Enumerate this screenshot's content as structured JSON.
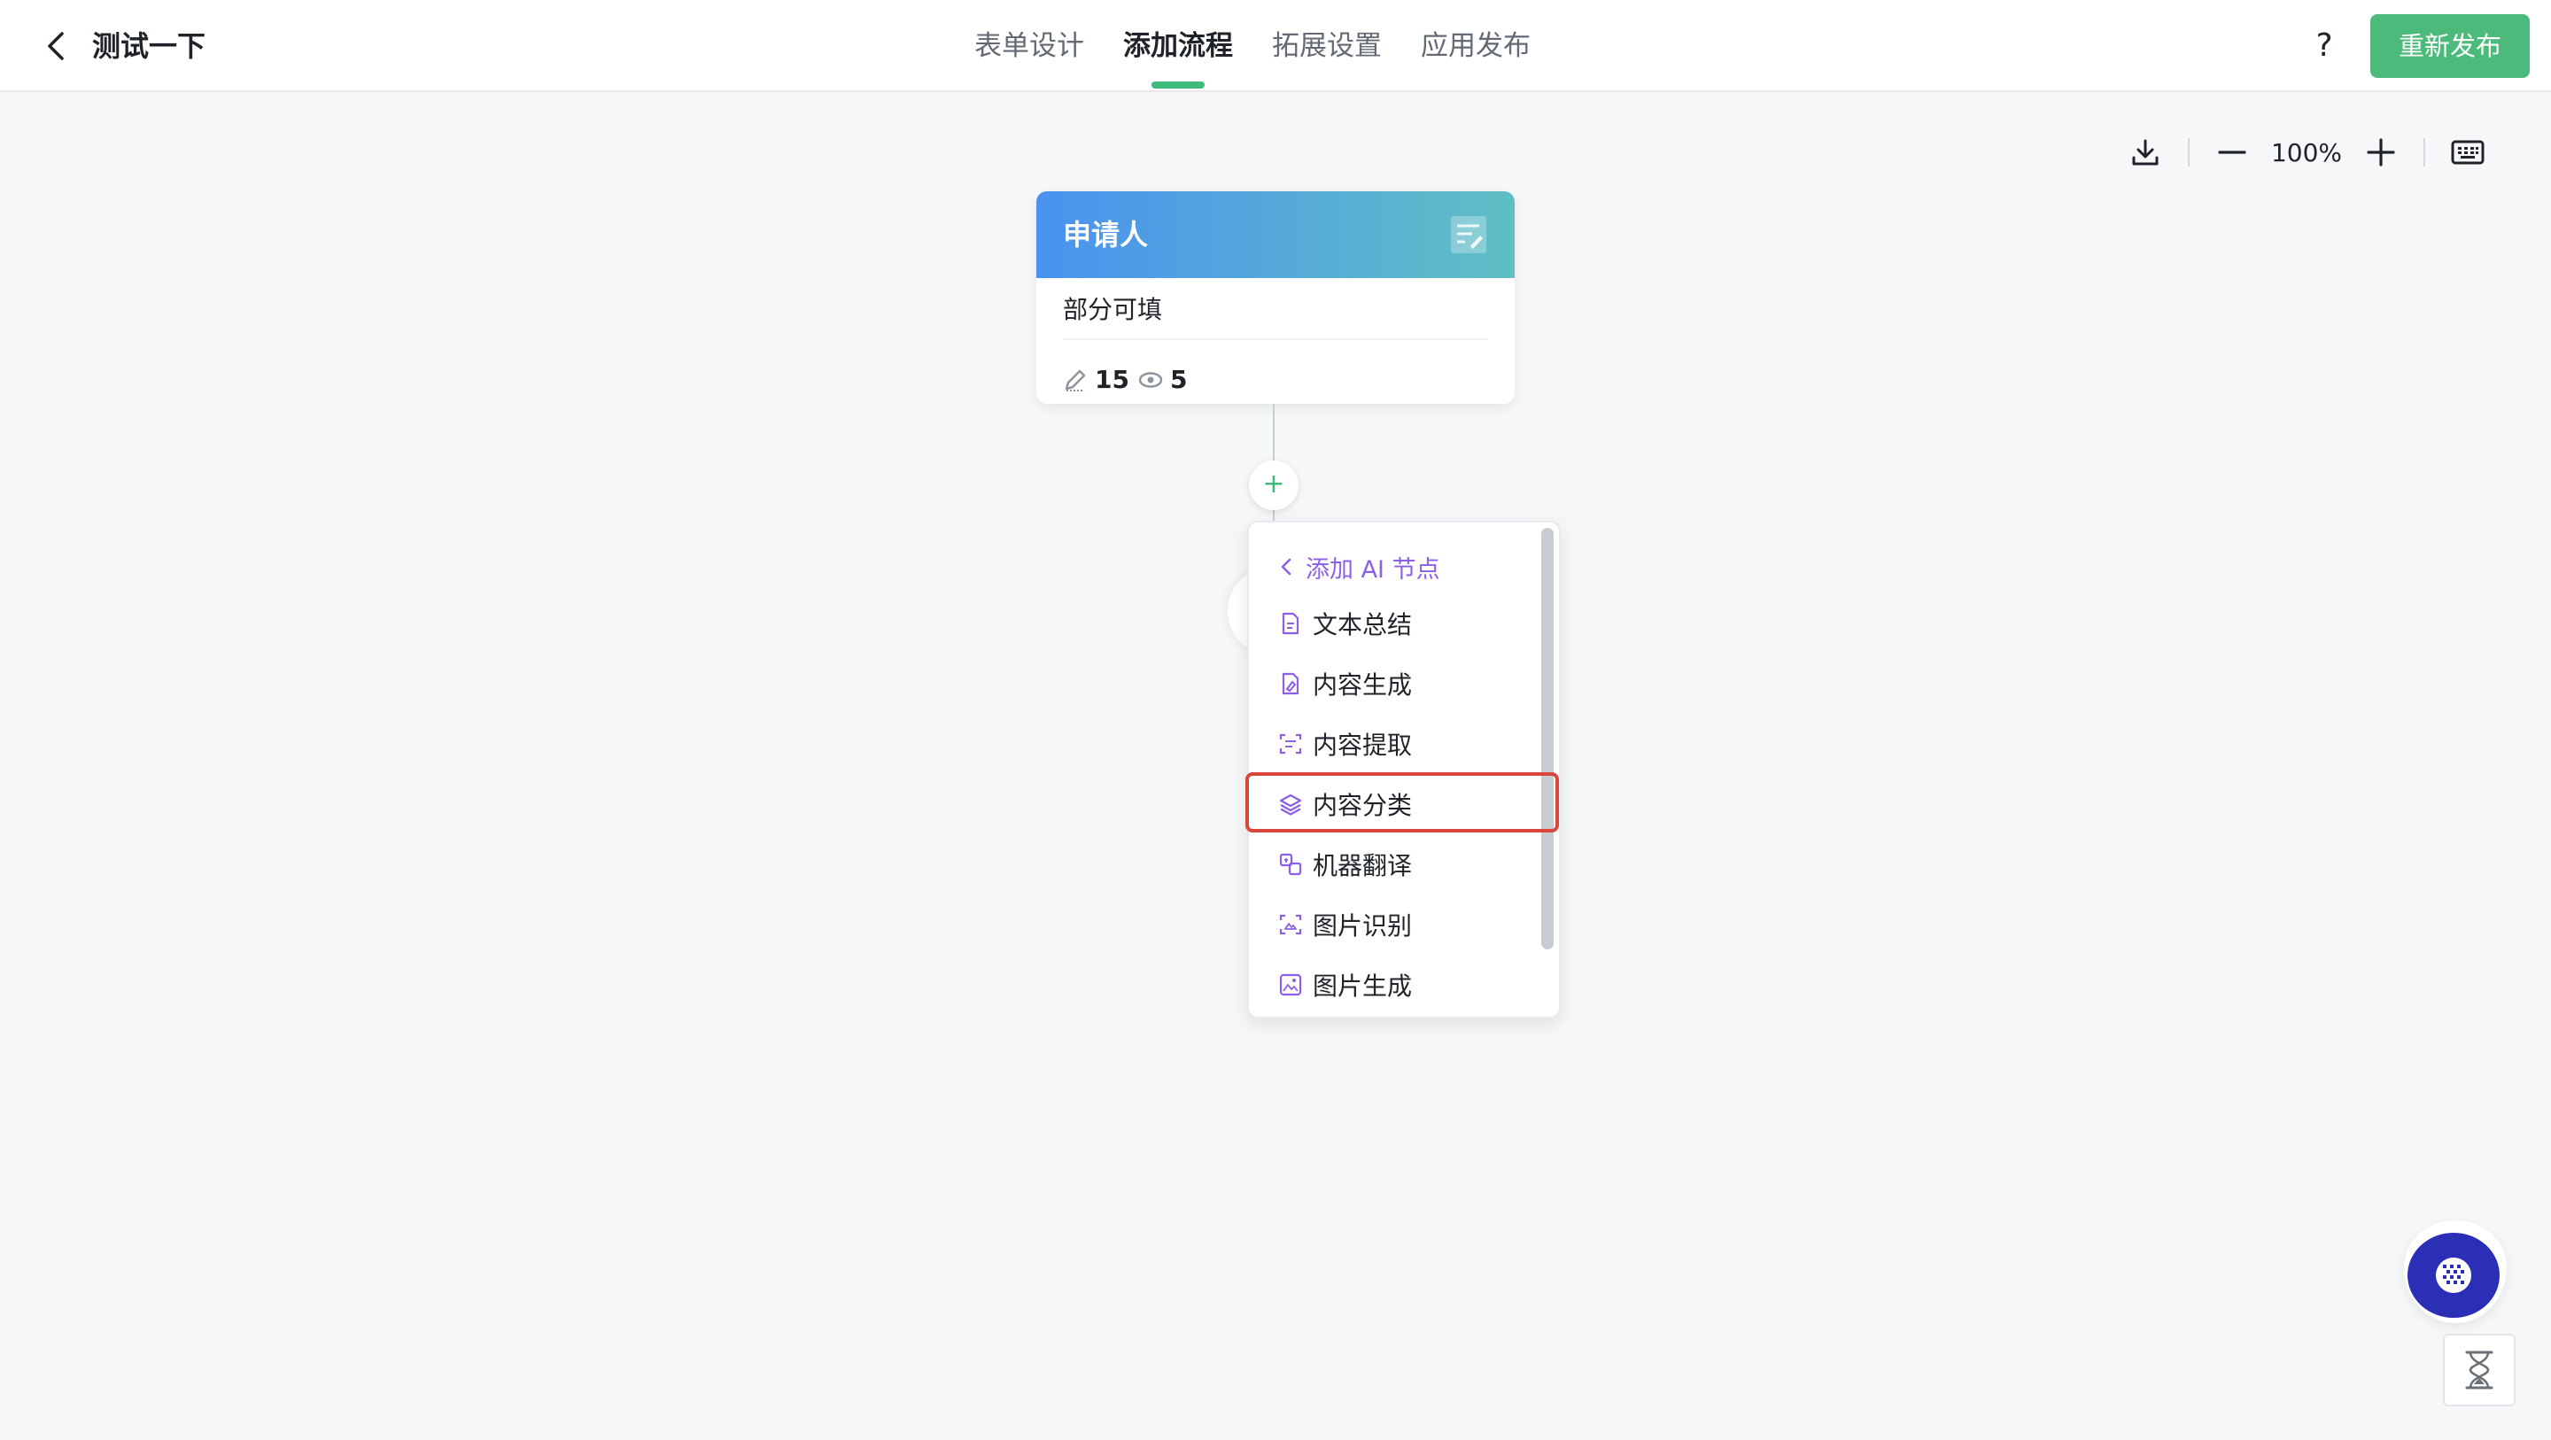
{
  "header": {
    "title": "测试一下",
    "tabs": [
      {
        "label": "表单设计",
        "active": false
      },
      {
        "label": "添加流程",
        "active": true
      },
      {
        "label": "拓展设置",
        "active": false
      },
      {
        "label": "应用发布",
        "active": false
      }
    ],
    "help_label": "?",
    "publish_label": "重新发布"
  },
  "toolbar": {
    "zoom": "100%",
    "icons": [
      "download-icon",
      "zoom-out-icon",
      "zoom-in-icon",
      "keyboard-icon"
    ]
  },
  "node": {
    "title": "申请人",
    "subtitle": "部分可填",
    "edit_count": "15",
    "view_count": "5"
  },
  "add_button_label": "+",
  "menu": {
    "header": "添加 AI 节点",
    "items": [
      {
        "label": "文本总结",
        "icon": "document-summary-icon"
      },
      {
        "label": "内容生成",
        "icon": "content-generate-icon"
      },
      {
        "label": "内容提取",
        "icon": "content-extract-icon"
      },
      {
        "label": "内容分类",
        "icon": "layers-icon",
        "highlighted": true
      },
      {
        "label": "机器翻译",
        "icon": "translate-icon"
      },
      {
        "label": "图片识别",
        "icon": "image-scan-icon"
      },
      {
        "label": "图片生成",
        "icon": "image-generate-icon"
      }
    ]
  },
  "colors": {
    "accent_green": "#4cba7a",
    "ai_purple": "#8c5fe8",
    "highlight_red": "#d9473a",
    "node_gradient_start": "#4a92ef",
    "node_gradient_end": "#5fbfc4",
    "fab_blue": "#2b2fb5"
  }
}
